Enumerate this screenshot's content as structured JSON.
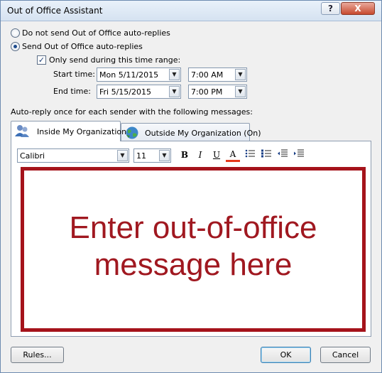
{
  "window": {
    "title": "Out of Office Assistant",
    "help_label": "?",
    "close_label": "X"
  },
  "options": {
    "do_not_send": "Do not send Out of Office auto-replies",
    "send": "Send Out of Office auto-replies",
    "selected": "send",
    "time_range_label": "Only send during this time range:",
    "time_range_checked": true
  },
  "start": {
    "label": "Start time:",
    "date": "Mon 5/11/2015",
    "time": "7:00 AM"
  },
  "end": {
    "label": "End time:",
    "date": "Fri 5/15/2015",
    "time": "7:00 PM"
  },
  "autoreply_label": "Auto-reply once for each sender with the following messages:",
  "tabs": [
    {
      "label": "Inside My Organization",
      "active": true
    },
    {
      "label": "Outside My Organization (On)",
      "active": false
    }
  ],
  "format_toolbar": {
    "font": "Calibri",
    "size": "11",
    "bold": "B",
    "italic": "I",
    "underline": "U",
    "font_color": "A",
    "font_color_hex": "#e63a1c"
  },
  "editor": {
    "message_line1": "Enter out-of-office",
    "message_line2": "message here",
    "highlight_color": "#a5131b"
  },
  "buttons": {
    "rules": "Rules...",
    "ok": "OK",
    "cancel": "Cancel"
  }
}
